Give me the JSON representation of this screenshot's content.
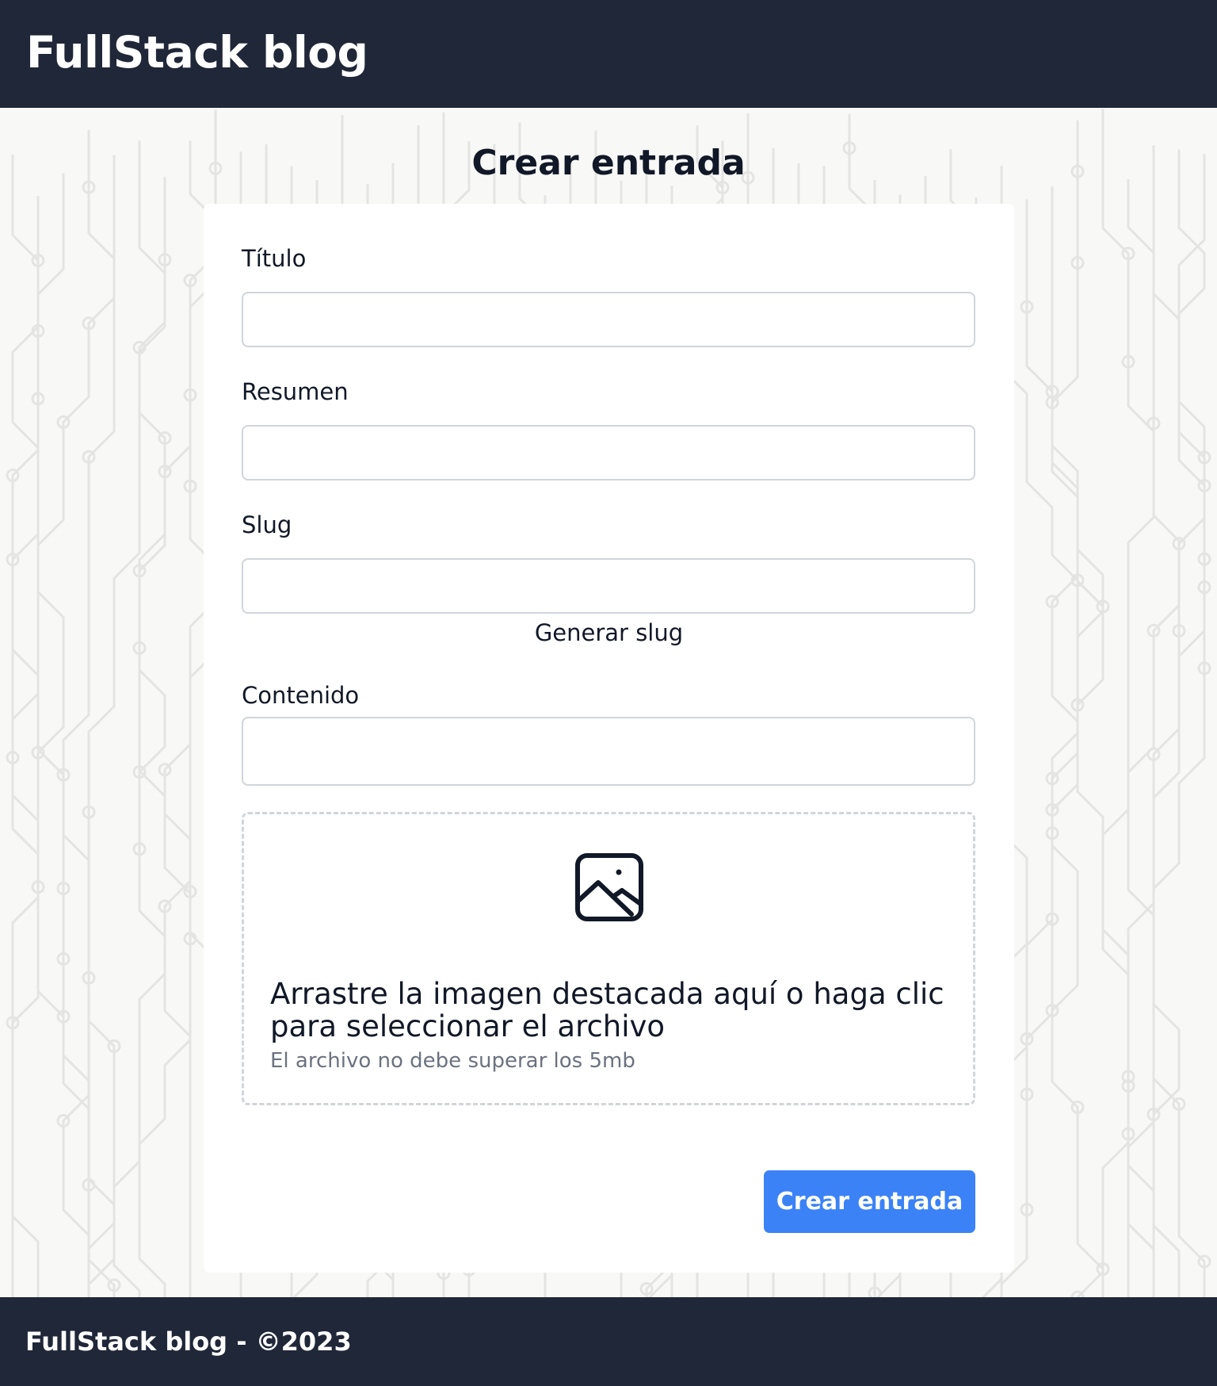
{
  "header": {
    "brand": "FullStack blog"
  },
  "page": {
    "title": "Crear entrada"
  },
  "form": {
    "title_label": "Título",
    "title_value": "",
    "summary_label": "Resumen",
    "summary_value": "",
    "slug_label": "Slug",
    "slug_value": "",
    "generate_slug_label": "Generar slug",
    "content_label": "Contenido",
    "content_value": "",
    "dropzone_text": "Arrastre la imagen destacada aquí o haga clic para seleccionar el archivo",
    "dropzone_hint": "El archivo no debe superar los 5mb",
    "dropzone_icon": "image-icon",
    "submit_label": "Crear entrada"
  },
  "footer": {
    "text": "FullStack blog - ©2023"
  },
  "colors": {
    "header_bg": "#1f2738",
    "accent": "#3b82f6",
    "page_bg": "#f8f8f7"
  }
}
